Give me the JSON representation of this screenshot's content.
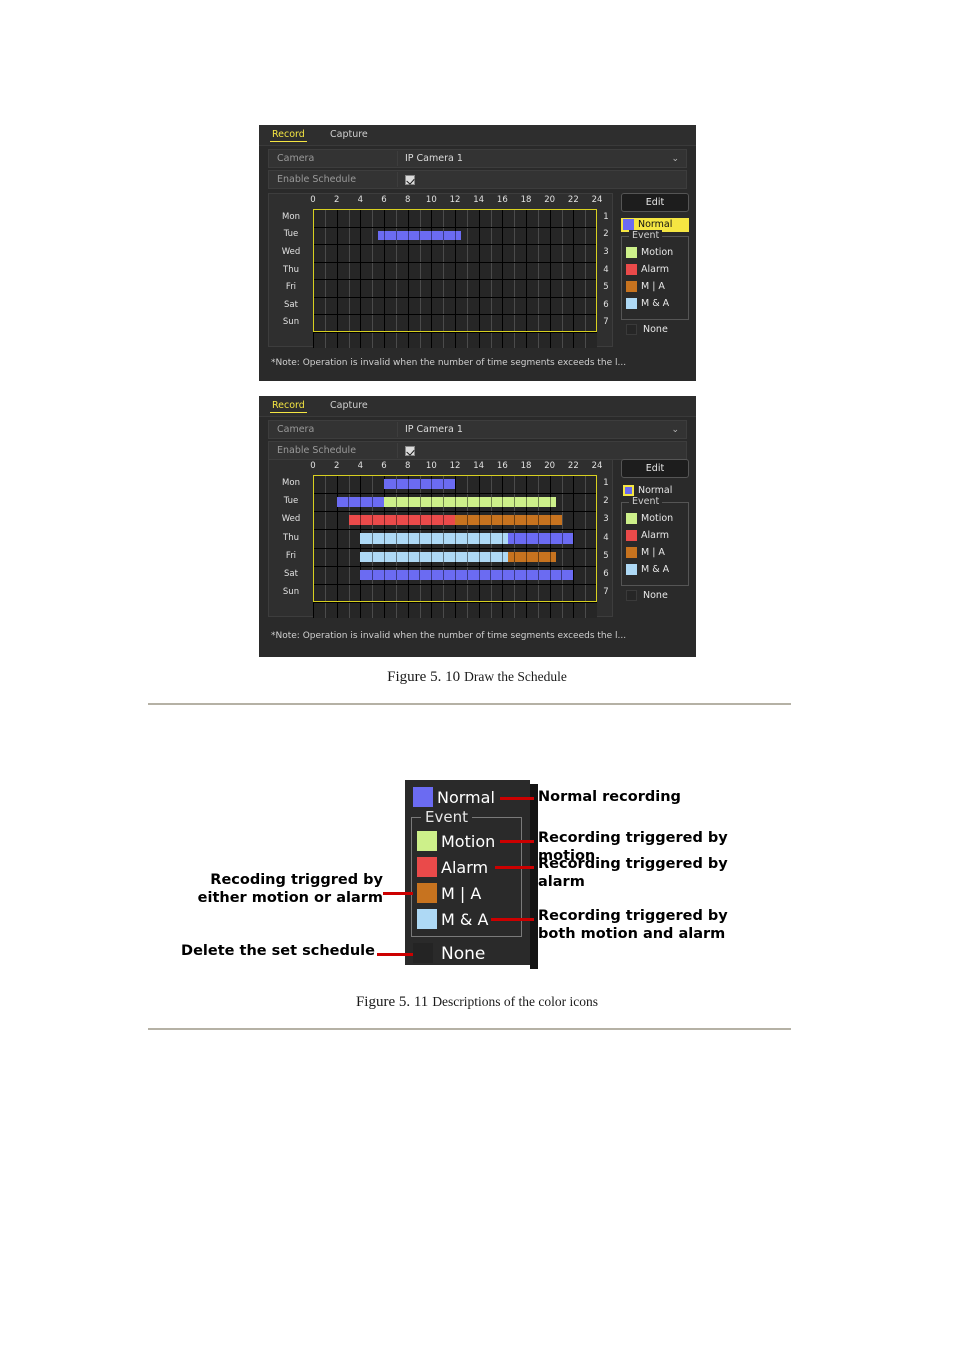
{
  "page": {
    "figure_10_caption_main": "Figure 5. 10",
    "figure_10_caption_sub": "Draw the Schedule",
    "figure_11_caption_main": "Figure 5. 11",
    "figure_11_caption_sub": "Descriptions of the color icons"
  },
  "colors": {
    "normal": "#6b6bf2",
    "motion": "#cdf08a",
    "alarm": "#ea4a4a",
    "m_or_a": "#c7731f",
    "m_and_a": "#aed9f5",
    "none": "#262626",
    "highlight": "#f5e642",
    "leader": "#cc0000"
  },
  "panel1": {
    "tabs": [
      {
        "label": "Record",
        "active": true
      },
      {
        "label": "Capture",
        "active": false
      }
    ],
    "camera": {
      "label": "Camera",
      "value": "IP Camera 1",
      "caret": "chevron-down"
    },
    "enable_schedule": {
      "label": "Enable Schedule",
      "checked": true
    },
    "hours": [
      "0",
      "2",
      "4",
      "6",
      "8",
      "10",
      "12",
      "14",
      "16",
      "18",
      "20",
      "22",
      "24"
    ],
    "days": [
      "Mon",
      "Tue",
      "Wed",
      "Thu",
      "Fri",
      "Sat",
      "Sun"
    ],
    "day_numbers": [
      "1",
      "2",
      "3",
      "4",
      "5",
      "6",
      "7"
    ],
    "segments": [
      {
        "day": 1,
        "start": 5.5,
        "end": 12.5,
        "type": "normal"
      }
    ],
    "edit_label": "Edit",
    "legend": {
      "normal_label": "Normal",
      "normal_highlighted": true,
      "event_title": "Event",
      "event_items": [
        {
          "label": "Motion",
          "color_key": "motion"
        },
        {
          "label": "Alarm",
          "color_key": "alarm"
        },
        {
          "label": "M | A",
          "color_key": "m_or_a"
        },
        {
          "label": "M & A",
          "color_key": "m_and_a"
        }
      ],
      "none_label": "None"
    },
    "note": "*Note: Operation is invalid when the number of time segments exceeds the l..."
  },
  "panel2": {
    "tabs": [
      {
        "label": "Record",
        "active": true
      },
      {
        "label": "Capture",
        "active": false
      }
    ],
    "camera": {
      "label": "Camera",
      "value": "IP Camera 1",
      "caret": "chevron-down"
    },
    "enable_schedule": {
      "label": "Enable Schedule",
      "checked": true
    },
    "hours": [
      "0",
      "2",
      "4",
      "6",
      "8",
      "10",
      "12",
      "14",
      "16",
      "18",
      "20",
      "22",
      "24"
    ],
    "days": [
      "Mon",
      "Tue",
      "Wed",
      "Thu",
      "Fri",
      "Sat",
      "Sun"
    ],
    "day_numbers": [
      "1",
      "2",
      "3",
      "4",
      "5",
      "6",
      "7"
    ],
    "segments": [
      {
        "day": 0,
        "start": 6.0,
        "end": 12.0,
        "type": "normal"
      },
      {
        "day": 1,
        "start": 2.0,
        "end": 6.0,
        "type": "normal"
      },
      {
        "day": 1,
        "start": 6.0,
        "end": 20.5,
        "type": "motion"
      },
      {
        "day": 2,
        "start": 3.0,
        "end": 12.0,
        "type": "alarm"
      },
      {
        "day": 2,
        "start": 12.0,
        "end": 21.0,
        "type": "m_or_a"
      },
      {
        "day": 3,
        "start": 4.0,
        "end": 16.5,
        "type": "m_and_a"
      },
      {
        "day": 3,
        "start": 16.5,
        "end": 22.0,
        "type": "normal"
      },
      {
        "day": 4,
        "start": 4.0,
        "end": 16.5,
        "type": "m_and_a"
      },
      {
        "day": 4,
        "start": 16.5,
        "end": 20.5,
        "type": "m_or_a"
      },
      {
        "day": 5,
        "start": 4.0,
        "end": 22.0,
        "type": "normal"
      }
    ],
    "edit_label": "Edit",
    "legend": {
      "normal_label": "Normal",
      "normal_highlighted": false,
      "normal_focused": true,
      "event_title": "Event",
      "event_items": [
        {
          "label": "Motion",
          "color_key": "motion"
        },
        {
          "label": "Alarm",
          "color_key": "alarm"
        },
        {
          "label": "M | A",
          "color_key": "m_or_a"
        },
        {
          "label": "M & A",
          "color_key": "m_and_a"
        }
      ],
      "none_label": "None"
    },
    "note": "*Note: Operation is invalid when the number of time segments exceeds the l..."
  },
  "figure11": {
    "legend": {
      "normal_label": "Normal",
      "event_title": "Event",
      "event_items": [
        {
          "label": "Motion",
          "color_key": "motion"
        },
        {
          "label": "Alarm",
          "color_key": "alarm"
        },
        {
          "label": "M | A",
          "color_key": "m_or_a"
        },
        {
          "label": "M & A",
          "color_key": "m_and_a"
        }
      ],
      "none_label": "None"
    },
    "annotations_right": [
      "Normal recording",
      "Recording triggered by\nmotion",
      "Recording triggered by\nalarm",
      "Recording triggered by\nboth motion and alarm"
    ],
    "annotations_left": [
      "Recoding triggred by\neither motion or alarm",
      "Delete the set schedule"
    ]
  }
}
